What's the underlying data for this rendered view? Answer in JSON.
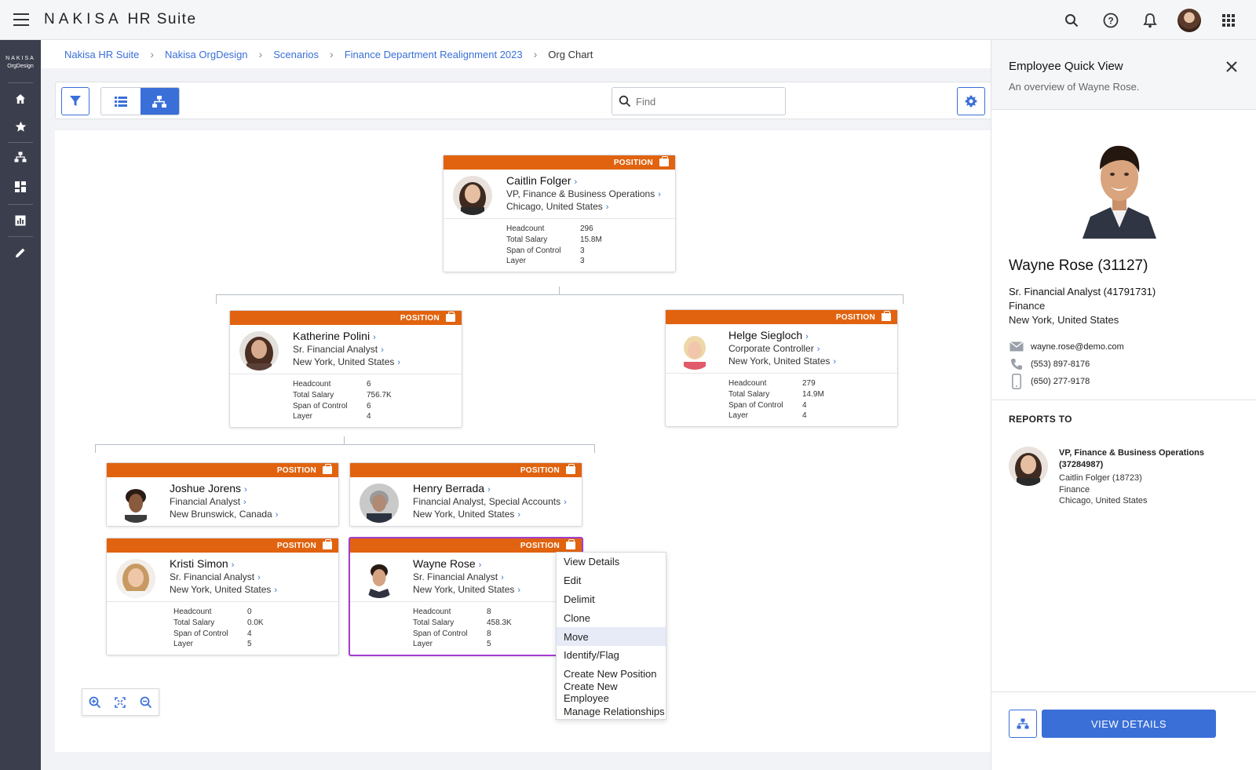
{
  "app": {
    "brand_main": "NAKISA",
    "brand_sub": "HR Suite"
  },
  "leftnav": {
    "logo_line1": "NAKISA",
    "logo_line2": "OrgDesign",
    "items": [
      "home-icon",
      "star-icon",
      "org-chart-icon",
      "dashboard-icon",
      "report-icon",
      "edit-icon"
    ]
  },
  "breadcrumb": {
    "items": [
      "Nakisa HR Suite",
      "Nakisa OrgDesign",
      "Scenarios",
      "Finance Department Realignment 2023"
    ],
    "current": "Org Chart"
  },
  "toolbar": {
    "search_placeholder": "Find"
  },
  "cards": {
    "position_label": "POSITION",
    "stat_labels": [
      "Headcount",
      "Total Salary",
      "Span of Control",
      "Layer"
    ],
    "caitlin": {
      "name": "Caitlin Folger",
      "title": "VP, Finance & Business Operations",
      "location": "Chicago, United States",
      "stats": [
        "296",
        "15.8M",
        "3",
        "3"
      ]
    },
    "katherine": {
      "name": "Katherine Polini",
      "title": "Sr. Financial Analyst",
      "location": "New York, United States",
      "stats": [
        "6",
        "756.7K",
        "6",
        "4"
      ]
    },
    "helge": {
      "name": "Helge Siegloch",
      "title": "Corporate Controller",
      "location": "New York, United States",
      "stats": [
        "279",
        "14.9M",
        "4",
        "4"
      ]
    },
    "joshue": {
      "name": "Joshue Jorens",
      "title": "Financial Analyst",
      "location": "New Brunswick, Canada"
    },
    "henry": {
      "name": "Henry  Berrada",
      "title": "Financial Analyst, Special Accounts",
      "location": "New York, United States"
    },
    "kristi": {
      "name": "Kristi Simon",
      "title": "Sr. Financial  Analyst",
      "location": "New York, United States",
      "stats": [
        "0",
        "0.0K",
        "4",
        "5"
      ]
    },
    "wayne": {
      "name": "Wayne Rose",
      "title": "Sr. Financial  Analyst",
      "location": "New York, United States",
      "stats": [
        "8",
        "458.3K",
        "8",
        "5"
      ]
    }
  },
  "context_menu": {
    "items": [
      "View Details",
      "Edit",
      "Delimit",
      "Clone",
      "Move",
      "Identify/Flag",
      "Create New Position",
      "Create New Employee",
      "Manage Relationships"
    ],
    "highlighted": "Move"
  },
  "panel": {
    "title": "Employee Quick View",
    "subtitle": "An overview of Wayne Rose.",
    "name": "Wayne Rose (31127)",
    "position": "Sr. Financial Analyst (41791731)",
    "department": "Finance",
    "location": "New York, United States",
    "email": "wayne.rose@demo.com",
    "phone": "(553) 897-8176",
    "mobile": "(650) 277-9178",
    "reports_to_label": "REPORTS TO",
    "manager": {
      "position": "VP, Finance & Business Operations (37284987)",
      "name": "Caitlin Folger (18723)",
      "department": "Finance",
      "location": "Chicago, United States"
    },
    "view_details_label": "VIEW DETAILS"
  },
  "colors": {
    "accent": "#3a6fd8",
    "position_header": "#e1630f",
    "selected_border": "#a23ecf",
    "nav_bg": "#3b3f4d"
  }
}
